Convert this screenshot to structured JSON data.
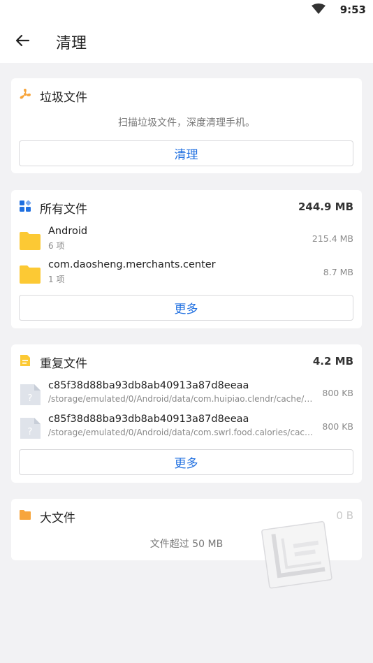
{
  "status": {
    "time": "9:53"
  },
  "app_bar": {
    "title": "清理"
  },
  "junk": {
    "title": "垃圾文件",
    "hint": "扫描垃圾文件，深度清理手机。",
    "button": "清理"
  },
  "all_files": {
    "title": "所有文件",
    "total": "244.9 MB",
    "items": [
      {
        "name": "Android",
        "sub": "6 项",
        "size": "215.4 MB"
      },
      {
        "name": "com.daosheng.merchants.center",
        "sub": "1 项",
        "size": "8.7 MB"
      }
    ],
    "button": "更多"
  },
  "duplicate": {
    "title": "重复文件",
    "total": "4.2 MB",
    "items": [
      {
        "name": "c85f38d88ba93db8ab40913a87d8eeaa",
        "sub": "/storage/emulated/0/Android/data/com.huipiao.clendr/cache/tt_t...",
        "size": "800 KB"
      },
      {
        "name": "c85f38d88ba93db8ab40913a87d8eeaa",
        "sub": "/storage/emulated/0/Android/data/com.swrl.food.calories/cache/...",
        "size": "800 KB"
      }
    ],
    "button": "更多"
  },
  "large": {
    "title": "大文件",
    "total": "0 B",
    "hint": "文件超过 50 MB"
  },
  "colors": {
    "accent": "#1f6fe0",
    "folder": "#fcc934",
    "orange": "#f7a53c"
  }
}
